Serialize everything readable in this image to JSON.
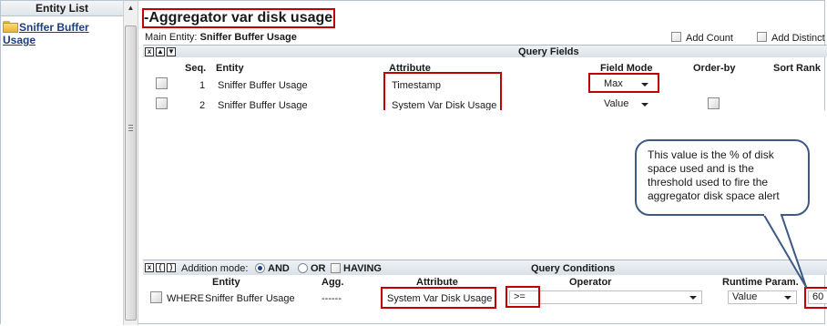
{
  "entity_list": {
    "header": "Entity List",
    "items": [
      {
        "label": "Sniffer Buffer Usage",
        "icon": "folder-icon"
      }
    ]
  },
  "query": {
    "title": "-Aggregator var disk usage",
    "main_entity_label": "Main Entity:",
    "main_entity_value": "Sniffer Buffer Usage",
    "add_count_label": "Add Count",
    "add_distinct_label": "Add Distinct"
  },
  "query_fields": {
    "section_title": "Query Fields",
    "columns": [
      "Seq.",
      "Entity",
      "Attribute",
      "Field Mode",
      "Order-by",
      "Sort Rank"
    ],
    "rows": [
      {
        "seq": "1",
        "entity": "Sniffer Buffer Usage",
        "attribute": "Timestamp",
        "field_mode": "Max"
      },
      {
        "seq": "2",
        "entity": "Sniffer Buffer Usage",
        "attribute": "System Var Disk Usage",
        "field_mode": "Value"
      }
    ]
  },
  "query_conditions": {
    "section_title": "Query Conditions",
    "addition_mode_label": "Addition mode:",
    "and_label": "AND",
    "or_label": "OR",
    "having_label": "HAVING",
    "selected_mode": "AND",
    "columns": [
      "Entity",
      "Agg.",
      "Attribute",
      "Operator",
      "Runtime Param."
    ],
    "row": {
      "clause": "WHERE",
      "entity": "Sniffer Buffer Usage",
      "agg": "------",
      "attribute": "System Var Disk Usage",
      "operator": ">=",
      "runtime_param": "Value",
      "value": "60"
    }
  },
  "callout": {
    "text": "This value is the % of disk space used and is the threshold used to fire the aggregator disk space alert"
  },
  "colors": {
    "annotation_red": "#c00000",
    "callout_border": "#3d5a85",
    "link_blue": "#1d3f7a"
  }
}
